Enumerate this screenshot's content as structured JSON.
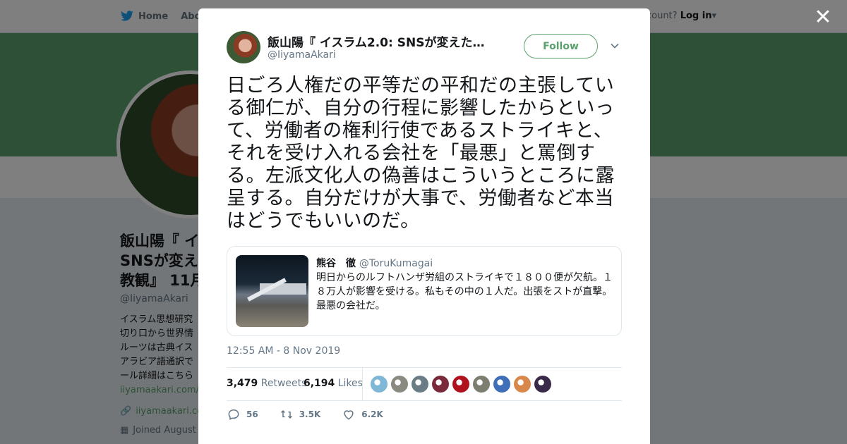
{
  "background": {
    "nav": {
      "home": "Home",
      "about": "Abo"
    },
    "topright_text": "ccount?",
    "login": "Log in",
    "profile_name": "飯山陽『 イ SNSが変え 教観』 11月",
    "profile_name_lines": [
      "飯山陽『 イ",
      "SNSが変え",
      "教観』 11月"
    ],
    "profile_handle": "@IiyamaAkari",
    "bio_lines": [
      "イスラム思想研究",
      "切り口から世界情",
      "ルーツは古典イス",
      "アラビア語通訳で",
      "ール詳細はこちら"
    ],
    "bio_link": "iiyamaakari.com/2",
    "website": "iiyamaakari.co",
    "joined": "Joined August",
    "accent": "#5aa16c"
  },
  "modal": {
    "author_name": "飯山陽『 イスラム2.0: SNSが変えた…",
    "author_handle": "@IiyamaAkari",
    "follow_label": "Follow",
    "tweet_text": "日ごろ人権だの平等だの平和だの主張している御仁が、自分の行程に影響したからといって、労働者の権利行使であるストライキと、それを受け入れる会社を「最悪」と罵倒する。左派文化人の偽善はこういうところに露呈する。自分だけが大事で、労働者など本当はどうでもいいのだ。",
    "quote": {
      "name": "熊谷　徹",
      "handle": "@ToruKumagai",
      "text": "明日からのルフトハンザ労組のストライキで１８００便が欠航。１８万人が影響を受ける。私もその中の１人だ。出張をストが直撃。最悪の会社だ。"
    },
    "timestamp": "12:55 AM - 8 Nov 2019",
    "retweets_count": "3,479",
    "retweets_label": "Retweets",
    "likes_count": "6,194",
    "likes_label": "Likes",
    "liker_colors": [
      "#7fb7d6",
      "#8a8a80",
      "#6a7d86",
      "#7a2a3a",
      "#b0121e",
      "#7d7d70",
      "#3f6fb8",
      "#d8884a",
      "#3a2a4a"
    ],
    "actions": {
      "replies": "56",
      "retweets": "3.5K",
      "likes": "6.2K"
    }
  }
}
